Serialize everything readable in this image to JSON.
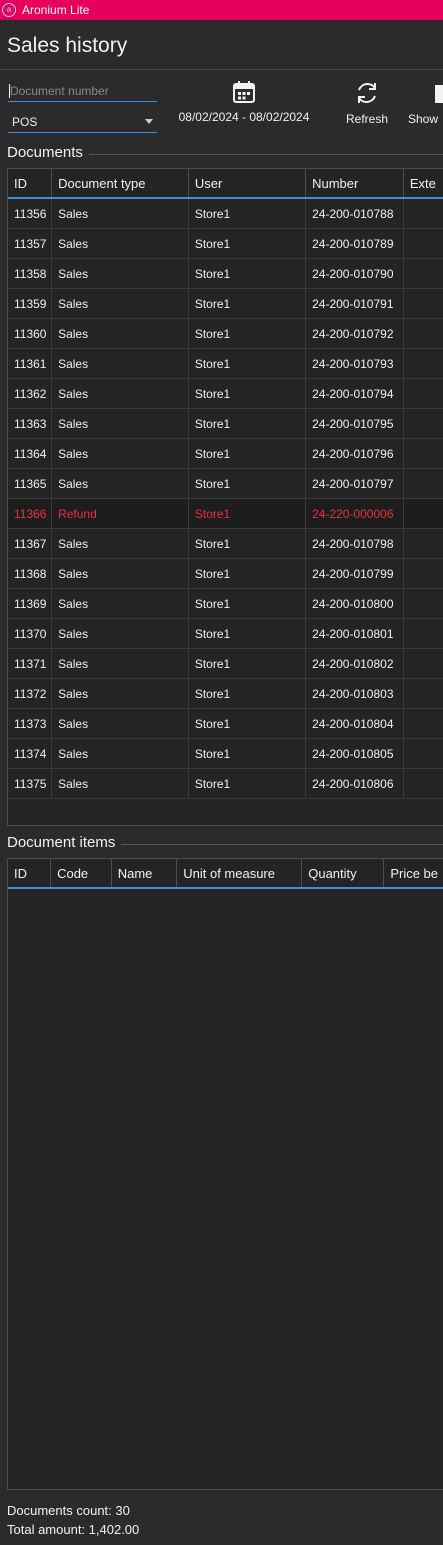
{
  "app": {
    "title": "Aronium Lite",
    "logo_glyph": "a"
  },
  "page": {
    "title": "Sales history"
  },
  "filters": {
    "document_number_placeholder": "Document number",
    "document_number_value": "",
    "store_select_value": "POS"
  },
  "toolbar": {
    "date_range_label": "08/02/2024 - 08/02/2024",
    "date_icon": "calendar-icon",
    "refresh_label": "Refresh",
    "refresh_icon": "refresh-icon",
    "show_label": "Show",
    "show_icon": "show-icon"
  },
  "documents": {
    "section_label": "Documents",
    "columns": [
      "ID",
      "Document type",
      "User",
      "Number",
      "Exte"
    ],
    "rows": [
      {
        "id": "11356",
        "type": "Sales",
        "user": "Store1",
        "number": "24-200-010788",
        "refund": false
      },
      {
        "id": "11357",
        "type": "Sales",
        "user": "Store1",
        "number": "24-200-010789",
        "refund": false
      },
      {
        "id": "11358",
        "type": "Sales",
        "user": "Store1",
        "number": "24-200-010790",
        "refund": false
      },
      {
        "id": "11359",
        "type": "Sales",
        "user": "Store1",
        "number": "24-200-010791",
        "refund": false
      },
      {
        "id": "11360",
        "type": "Sales",
        "user": "Store1",
        "number": "24-200-010792",
        "refund": false
      },
      {
        "id": "11361",
        "type": "Sales",
        "user": "Store1",
        "number": "24-200-010793",
        "refund": false
      },
      {
        "id": "11362",
        "type": "Sales",
        "user": "Store1",
        "number": "24-200-010794",
        "refund": false
      },
      {
        "id": "11363",
        "type": "Sales",
        "user": "Store1",
        "number": "24-200-010795",
        "refund": false
      },
      {
        "id": "11364",
        "type": "Sales",
        "user": "Store1",
        "number": "24-200-010796",
        "refund": false
      },
      {
        "id": "11365",
        "type": "Sales",
        "user": "Store1",
        "number": "24-200-010797",
        "refund": false
      },
      {
        "id": "11366",
        "type": "Refund",
        "user": "Store1",
        "number": "24-220-000006",
        "refund": true
      },
      {
        "id": "11367",
        "type": "Sales",
        "user": "Store1",
        "number": "24-200-010798",
        "refund": false
      },
      {
        "id": "11368",
        "type": "Sales",
        "user": "Store1",
        "number": "24-200-010799",
        "refund": false
      },
      {
        "id": "11369",
        "type": "Sales",
        "user": "Store1",
        "number": "24-200-010800",
        "refund": false
      },
      {
        "id": "11370",
        "type": "Sales",
        "user": "Store1",
        "number": "24-200-010801",
        "refund": false
      },
      {
        "id": "11371",
        "type": "Sales",
        "user": "Store1",
        "number": "24-200-010802",
        "refund": false
      },
      {
        "id": "11372",
        "type": "Sales",
        "user": "Store1",
        "number": "24-200-010803",
        "refund": false
      },
      {
        "id": "11373",
        "type": "Sales",
        "user": "Store1",
        "number": "24-200-010804",
        "refund": false
      },
      {
        "id": "11374",
        "type": "Sales",
        "user": "Store1",
        "number": "24-200-010805",
        "refund": false
      },
      {
        "id": "11375",
        "type": "Sales",
        "user": "Store1",
        "number": "24-200-010806",
        "refund": false
      }
    ]
  },
  "document_items": {
    "section_label": "Document items",
    "columns": [
      "ID",
      "Code",
      "Name",
      "Unit of measure",
      "Quantity",
      "Price be"
    ]
  },
  "footer": {
    "documents_count": "Documents count: 30",
    "total_amount": "Total amount: 1,402.00"
  },
  "colors": {
    "title_bar": "#e6005c",
    "accent": "#3a8fd6",
    "refund_text": "#e8323c",
    "background": "#2b2b2b"
  }
}
